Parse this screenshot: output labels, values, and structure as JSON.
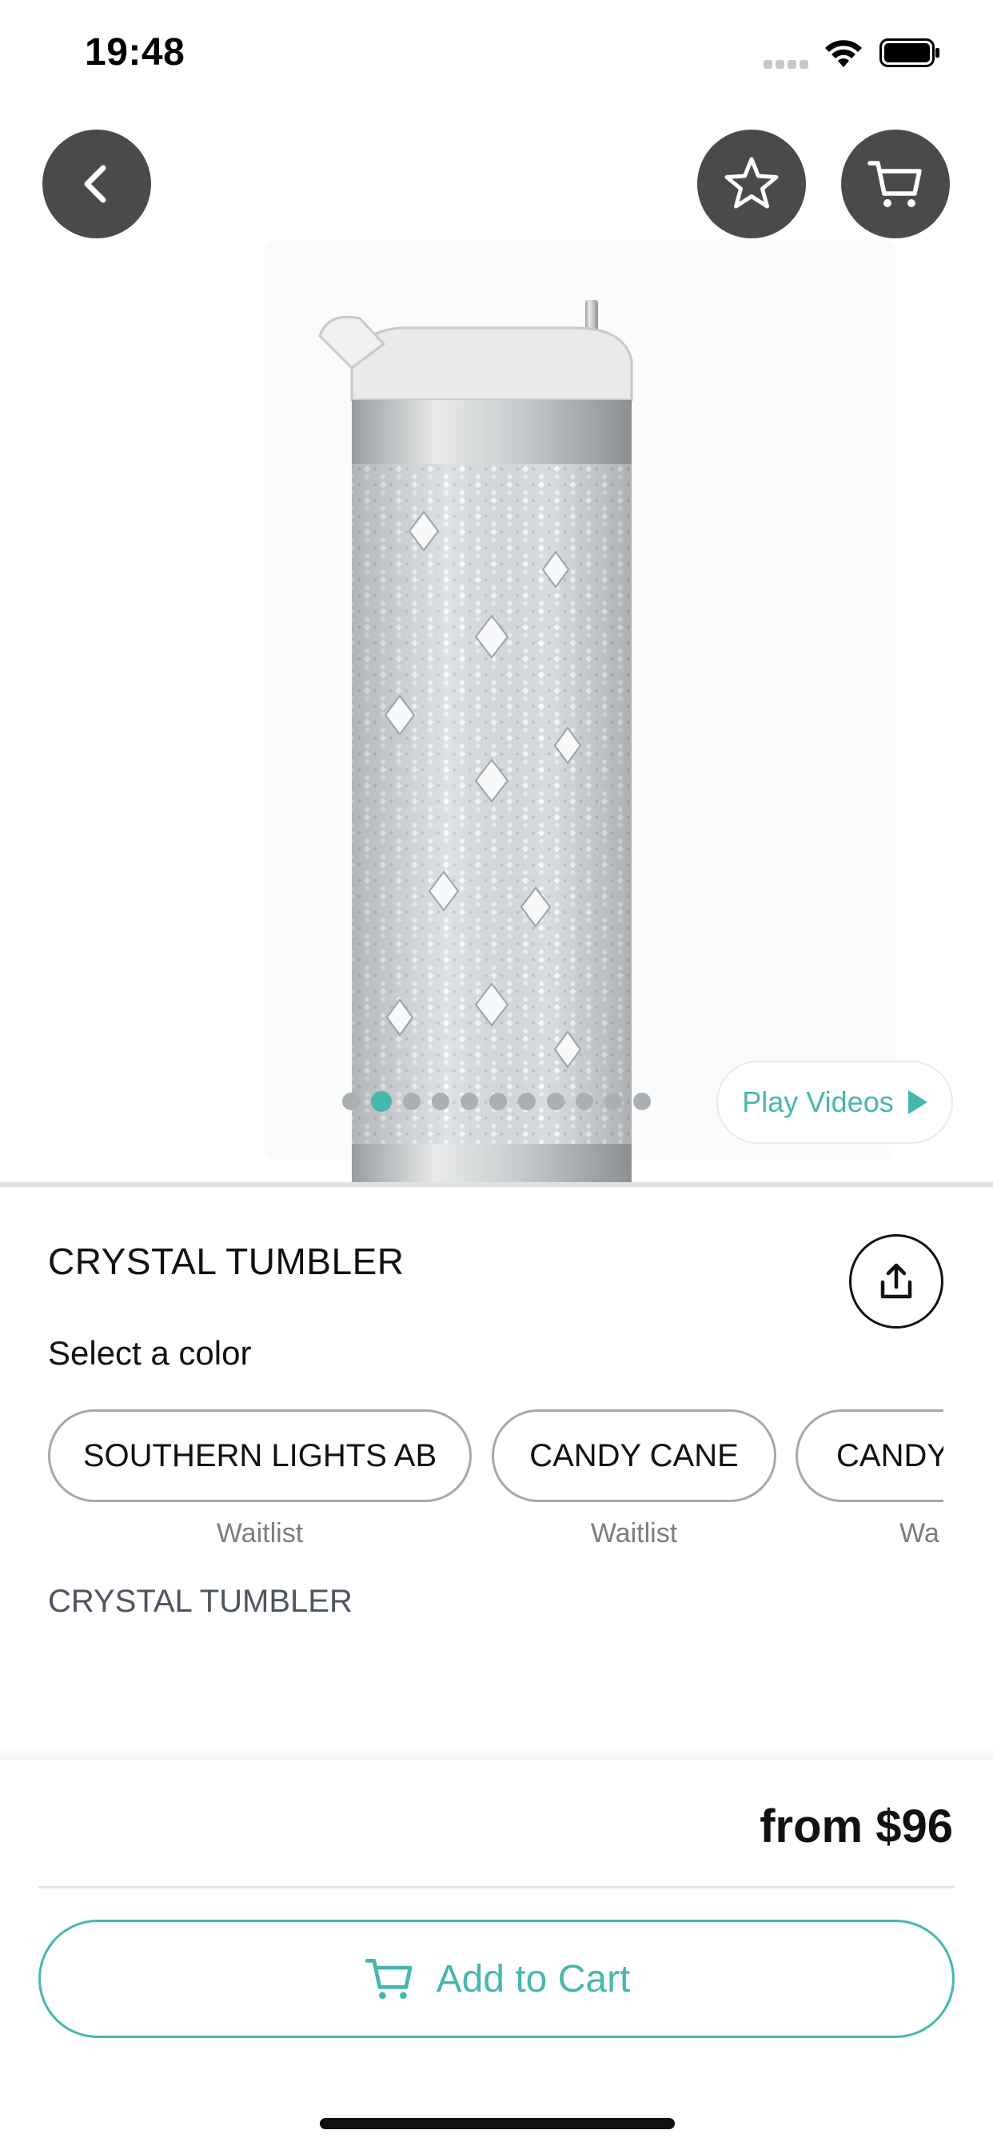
{
  "status_bar": {
    "time": "19:48",
    "signal_icon": "cellular-signal-icon",
    "wifi_icon": "wifi-icon",
    "battery_icon": "battery-icon"
  },
  "header": {
    "back_icon": "chevron-left-icon",
    "favorite_icon": "star-icon",
    "cart_icon": "shopping-cart-icon"
  },
  "gallery": {
    "image_alt": "Crystal tumbler product photo",
    "dot_count": 11,
    "active_index": 1,
    "play_videos_label": "Play Videos"
  },
  "product": {
    "title": "CRYSTAL TUMBLER",
    "share_icon": "share-icon",
    "select_color_label": "Select a color",
    "colors": [
      {
        "label": "SOUTHERN LIGHTS AB",
        "status": "Waitlist"
      },
      {
        "label": "CANDY CANE",
        "status": "Waitlist"
      },
      {
        "label": "CANDY",
        "status": "Wa"
      }
    ],
    "description": "CRYSTAL TUMBLER"
  },
  "purchase": {
    "price": "from $96",
    "add_to_cart_label": "Add to Cart"
  },
  "colors_theme": {
    "accent": "#46b7ae",
    "icon_button_bg": "#4a4a4a",
    "dot_inactive": "#a9b0b5"
  }
}
